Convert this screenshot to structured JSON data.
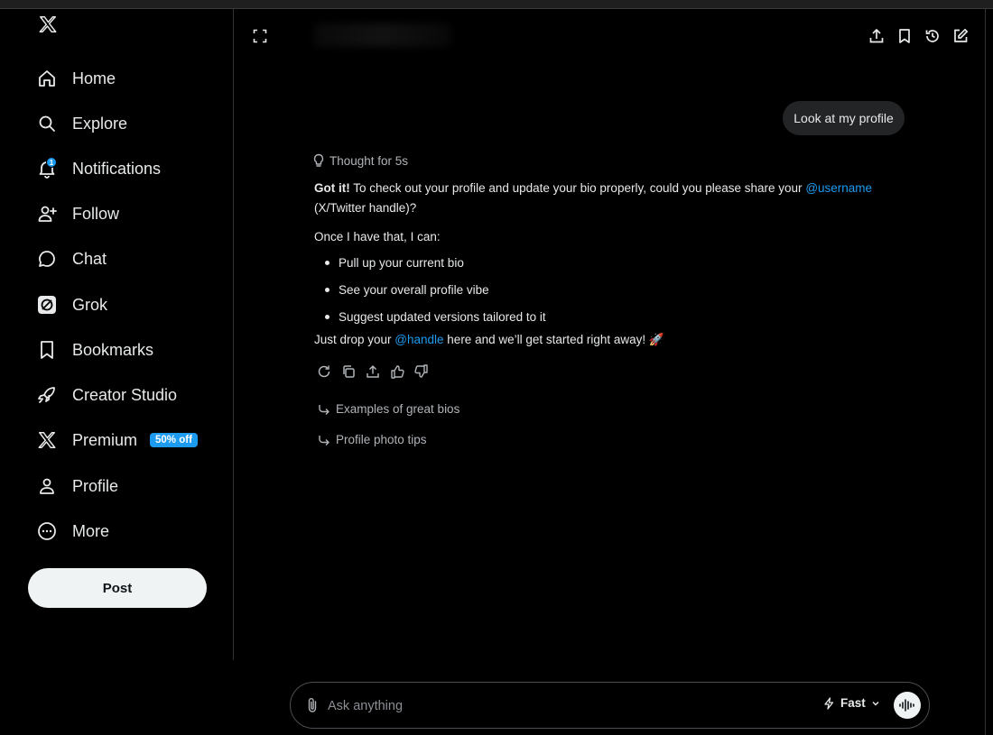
{
  "nav": {
    "items": [
      {
        "label": "Home",
        "icon": "home-icon"
      },
      {
        "label": "Explore",
        "icon": "search-icon"
      },
      {
        "label": "Notifications",
        "icon": "bell-icon",
        "badge": "1"
      },
      {
        "label": "Follow",
        "icon": "person-add-icon"
      },
      {
        "label": "Chat",
        "icon": "chat-bubble-icon"
      },
      {
        "label": "Grok",
        "icon": "grok-icon"
      },
      {
        "label": "Bookmarks",
        "icon": "bookmark-icon"
      },
      {
        "label": "Creator Studio",
        "icon": "rocket-icon"
      },
      {
        "label": "Premium",
        "icon": "x-logo-icon",
        "badge": "50% off"
      },
      {
        "label": "Profile",
        "icon": "person-icon"
      },
      {
        "label": "More",
        "icon": "more-circle-icon"
      }
    ],
    "post_label": "Post"
  },
  "chat": {
    "user_message": "Look at my profile",
    "thought_label": "Thought for 5s",
    "reply": {
      "p1_bold": "Got it!",
      "p1_text": " To check out your profile and update your bio properly, could you please share your ",
      "p1_mention": "@username",
      "p1_line2": "(X/Twitter handle)?",
      "p2": "Once I have that, I can:",
      "bullets": [
        "Pull up your current bio",
        "See your overall profile vibe",
        "Suggest updated versions tailored to it"
      ],
      "p3_pre": "Just drop your ",
      "p3_mention": "@handle",
      "p3_post": " here and we’ll get started right away! ",
      "p3_emoji": "🚀"
    },
    "suggestions": [
      "Examples of great bios",
      "Profile photo tips"
    ]
  },
  "composer": {
    "placeholder": "Ask anything",
    "mode_label": "Fast"
  },
  "colors": {
    "accent": "#1d9bf0",
    "background": "#000000",
    "bubble": "#232426"
  }
}
